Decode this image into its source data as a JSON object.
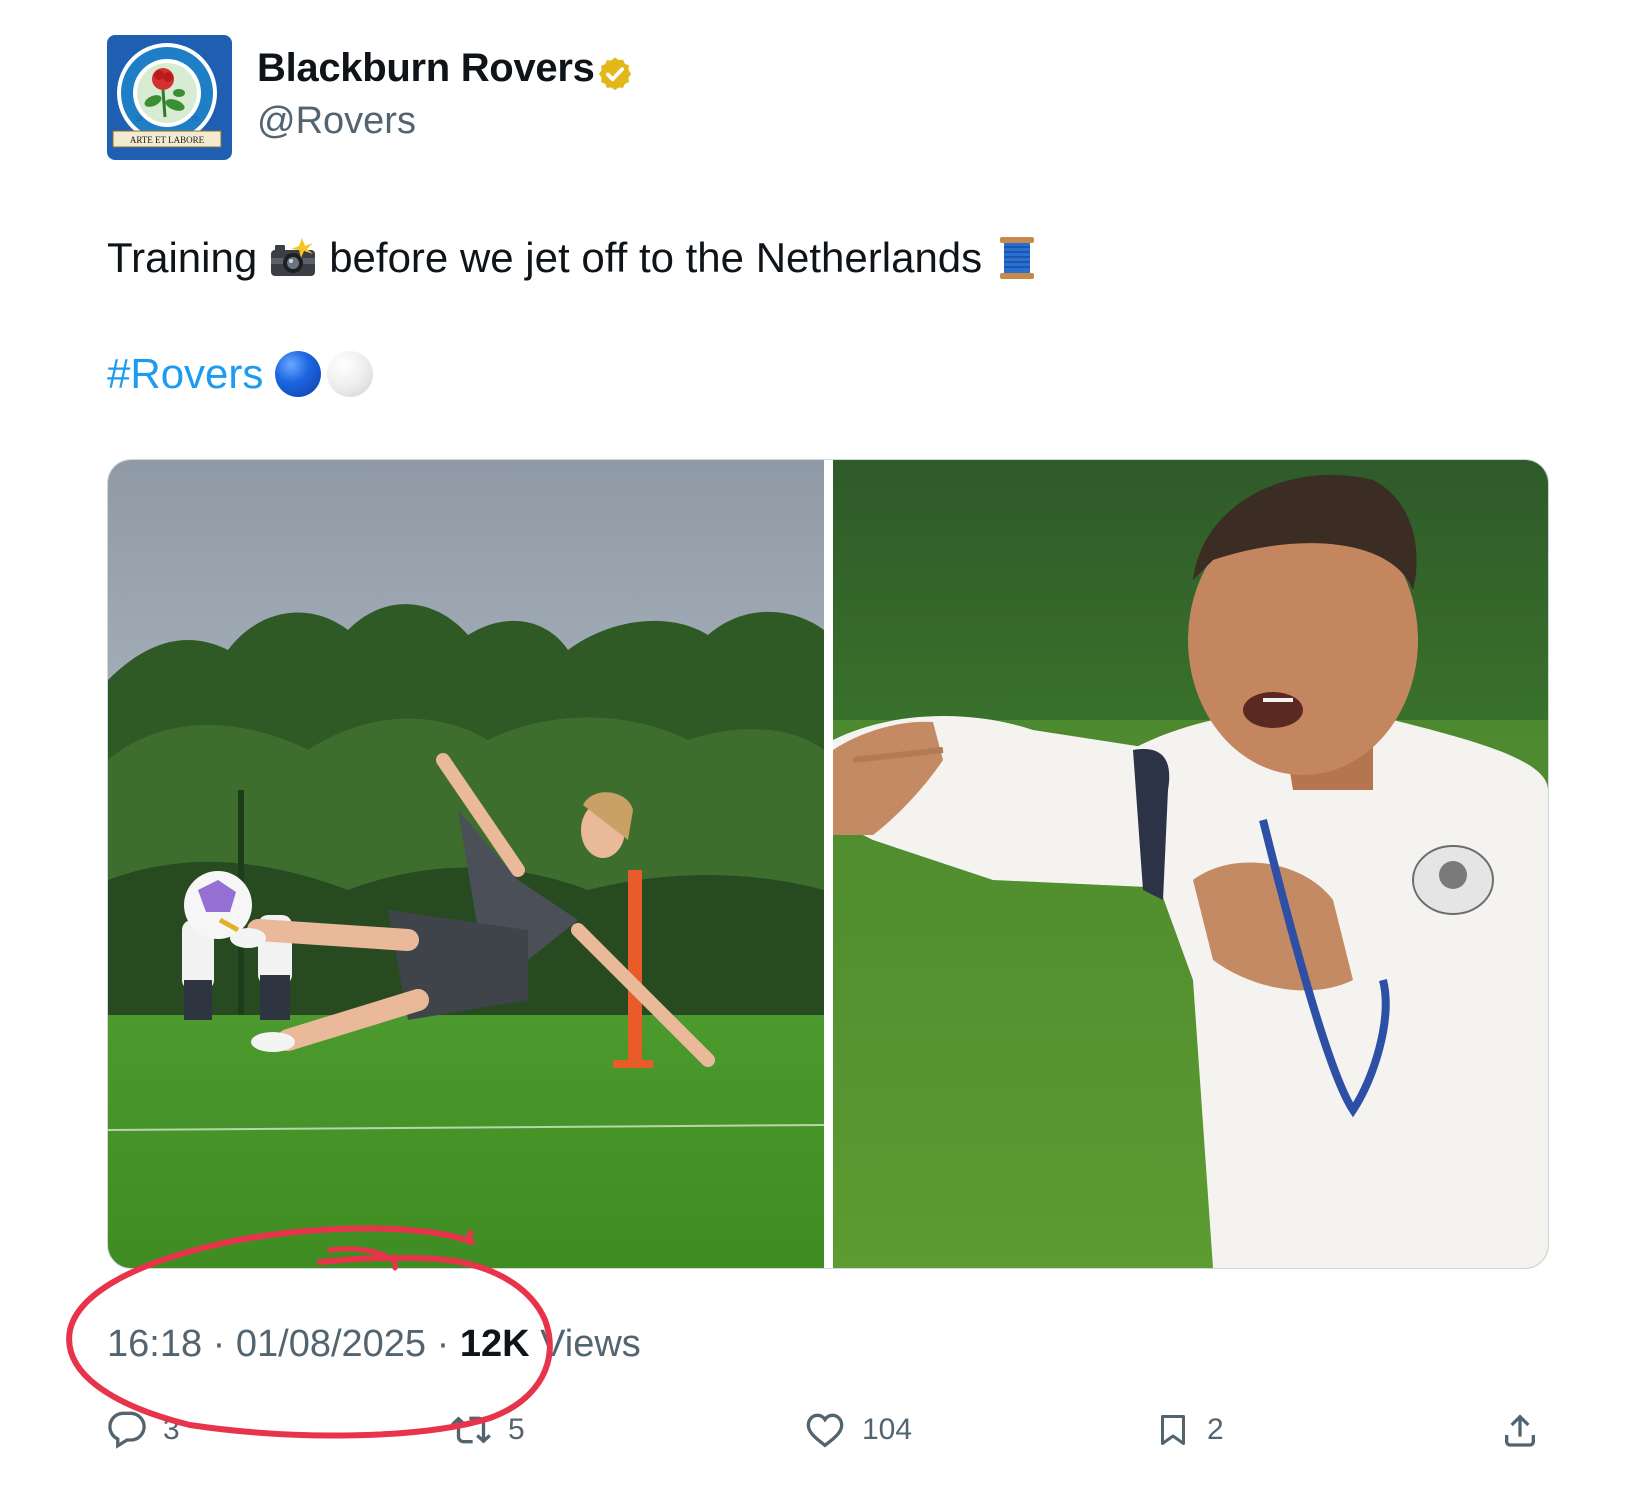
{
  "author": {
    "display_name": "Blackburn Rovers",
    "handle": "@Rovers",
    "avatar_icon": "blackburn-rovers-crest",
    "avatar_motto": "ARTE ET LABORE",
    "verified_icon": "verified-gold-badge-icon"
  },
  "tweet": {
    "text_part1": "Training",
    "text_part2": "before we jet off to the Netherlands",
    "emoji_1": "camera-with-flash-icon",
    "emoji_2": "spool-of-thread-icon",
    "hashtag": "#Rovers",
    "hashtag_emojis": [
      "blue-circle-icon",
      "white-circle-icon"
    ]
  },
  "media": {
    "photos": [
      {
        "name": "player-diving-volley-photo"
      },
      {
        "name": "coach-pointing-photo"
      }
    ]
  },
  "meta": {
    "time": "16:18",
    "separator": " · ",
    "date": "01/08/2025",
    "views_count": "12K",
    "views_label": "Views"
  },
  "actions": {
    "replies": "3",
    "retweets": "5",
    "likes": "104",
    "bookmarks": "2"
  },
  "colors": {
    "link": "#1d9bf0",
    "secondary_text": "#536471",
    "annotation": "#e8344a",
    "verified_gold": "#e2b719"
  }
}
